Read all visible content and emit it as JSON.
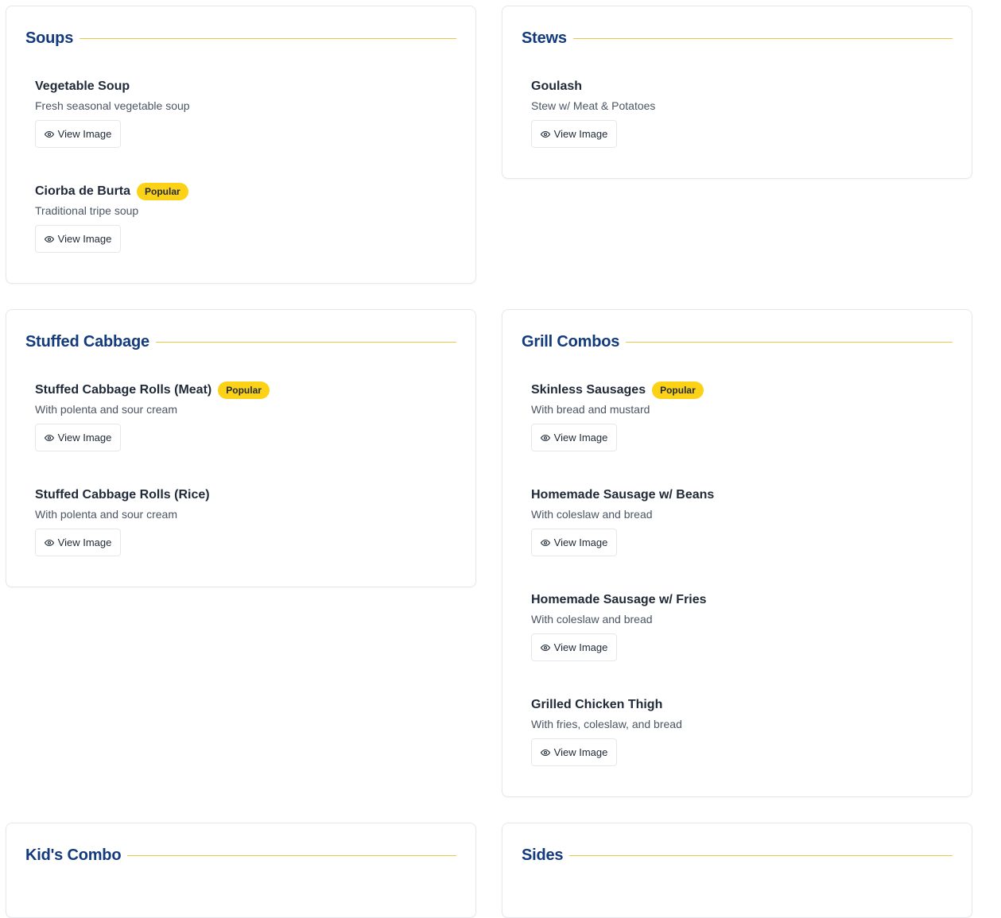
{
  "sections": [
    {
      "title": "Soups",
      "items": [
        {
          "name": "Vegetable Soup",
          "description": "Fresh seasonal vegetable soup",
          "badge": "",
          "button": "View Image"
        },
        {
          "name": "Ciorba de Burta",
          "description": "Traditional tripe soup",
          "badge": "Popular",
          "button": "View Image"
        }
      ]
    },
    {
      "title": "Stews",
      "items": [
        {
          "name": "Goulash",
          "description": "Stew w/ Meat & Potatoes",
          "badge": "",
          "button": "View Image"
        }
      ]
    },
    {
      "title": "Stuffed Cabbage",
      "items": [
        {
          "name": "Stuffed Cabbage Rolls (Meat)",
          "description": "With polenta and sour cream",
          "badge": "Popular",
          "button": "View Image"
        },
        {
          "name": "Stuffed Cabbage Rolls (Rice)",
          "description": "With polenta and sour cream",
          "badge": "",
          "button": "View Image"
        }
      ]
    },
    {
      "title": "Grill Combos",
      "items": [
        {
          "name": "Skinless Sausages",
          "description": "With bread and mustard",
          "badge": "Popular",
          "button": "View Image"
        },
        {
          "name": "Homemade Sausage w/ Beans",
          "description": "With coleslaw and bread",
          "badge": "",
          "button": "View Image"
        },
        {
          "name": "Homemade Sausage w/ Fries",
          "description": "With coleslaw and bread",
          "badge": "",
          "button": "View Image"
        },
        {
          "name": "Grilled Chicken Thigh",
          "description": "With fries, coleslaw, and bread",
          "badge": "",
          "button": "View Image"
        }
      ]
    },
    {
      "title": "Kid's Combo",
      "items": []
    },
    {
      "title": "Sides",
      "items": []
    }
  ],
  "colors": {
    "section_title": "#133a7c",
    "rule": "#e8c84a",
    "badge_bg": "#fcd217"
  }
}
